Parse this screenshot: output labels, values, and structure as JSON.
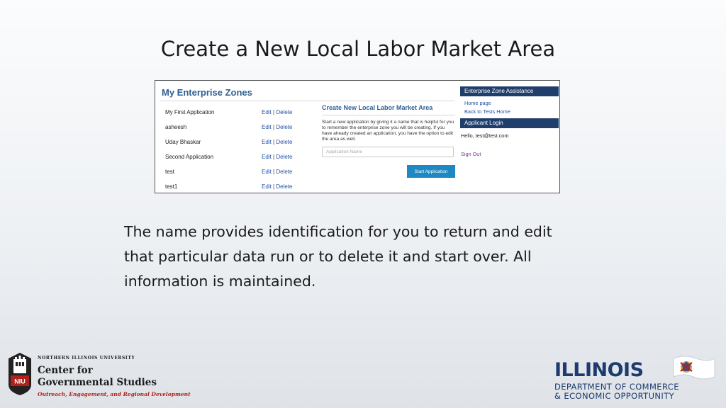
{
  "slide": {
    "title": "Create a New Local Labor Market Area",
    "body": "The name provides identification for you to return and edit that particular data run or to delete it and start over.  All information is maintained."
  },
  "screenshot": {
    "heading": "My Enterprise Zones",
    "applications": [
      {
        "name": "My First Application",
        "edit": "Edit",
        "sep": " | ",
        "delete": "Delete"
      },
      {
        "name": "asheesh",
        "edit": "Edit",
        "sep": " | ",
        "delete": "Delete"
      },
      {
        "name": "Uday Bhaskar",
        "edit": "Edit",
        "sep": " | ",
        "delete": "Delete"
      },
      {
        "name": "Second Application",
        "edit": "Edit",
        "sep": " | ",
        "delete": "Delete"
      },
      {
        "name": "test",
        "edit": "Edit",
        "sep": " | ",
        "delete": "Delete"
      },
      {
        "name": "test1",
        "edit": "Edit",
        "sep": " | ",
        "delete": "Delete"
      }
    ],
    "create": {
      "title": "Create New Local Labor Market Area",
      "description": "Start a new application by giving it a name that is helpful for you to remember the enterprise zone you will be creating. If you have already created an application, you have the option to edit the area as well.",
      "placeholder": "Application Name",
      "button": "Start Application"
    },
    "sidebar": {
      "assistance_heading": "Enterprise Zone Assistance",
      "links": [
        "Home page",
        "Back to Tests Home"
      ],
      "login_heading": "Applicant Login",
      "greeting": "Hello, test@test.com",
      "signout": "Sign Out"
    }
  },
  "footer": {
    "niu": {
      "university": "NORTHERN ILLINOIS UNIVERSITY",
      "center_line1": "Center for",
      "center_line2": "Governmental Studies",
      "tagline": "Outreach, Engagement, and Regional Development",
      "shield_text": "NIU"
    },
    "illinois": {
      "name": "ILLINOIS",
      "line1": "DEPARTMENT OF COMMERCE",
      "line2": "& ECONOMIC OPPORTUNITY"
    }
  },
  "colors": {
    "heading_blue": "#2f5f93",
    "sidebar_navy": "#1f3e6b",
    "button_blue": "#1e88c2",
    "niu_red": "#b1211c",
    "illinois_navy": "#1d3b6e"
  }
}
